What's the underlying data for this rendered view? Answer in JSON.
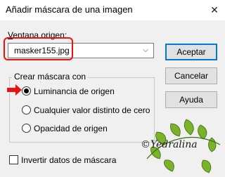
{
  "window": {
    "title": "Añadir máscara de una imagen",
    "close_icon": "close-icon"
  },
  "source": {
    "label": "Ventana origen:",
    "value": "masker155.jpg"
  },
  "buttons": {
    "accept": "Aceptar",
    "cancel": "Cancelar",
    "help": "Ayuda"
  },
  "group": {
    "title": "Crear máscara con",
    "options": [
      {
        "label": "Luminancia de origen",
        "selected": true
      },
      {
        "label": "Cualquier valor distinto de cero",
        "selected": false
      },
      {
        "label": "Opacidad de origen",
        "selected": false
      }
    ]
  },
  "invert": {
    "label": "Invertir datos de máscara",
    "checked": false
  },
  "watermark": {
    "text": "©Yedralina"
  },
  "colors": {
    "highlight": "#e11111",
    "accent": "#0078d7",
    "leaf_green": "#7ab22a"
  }
}
